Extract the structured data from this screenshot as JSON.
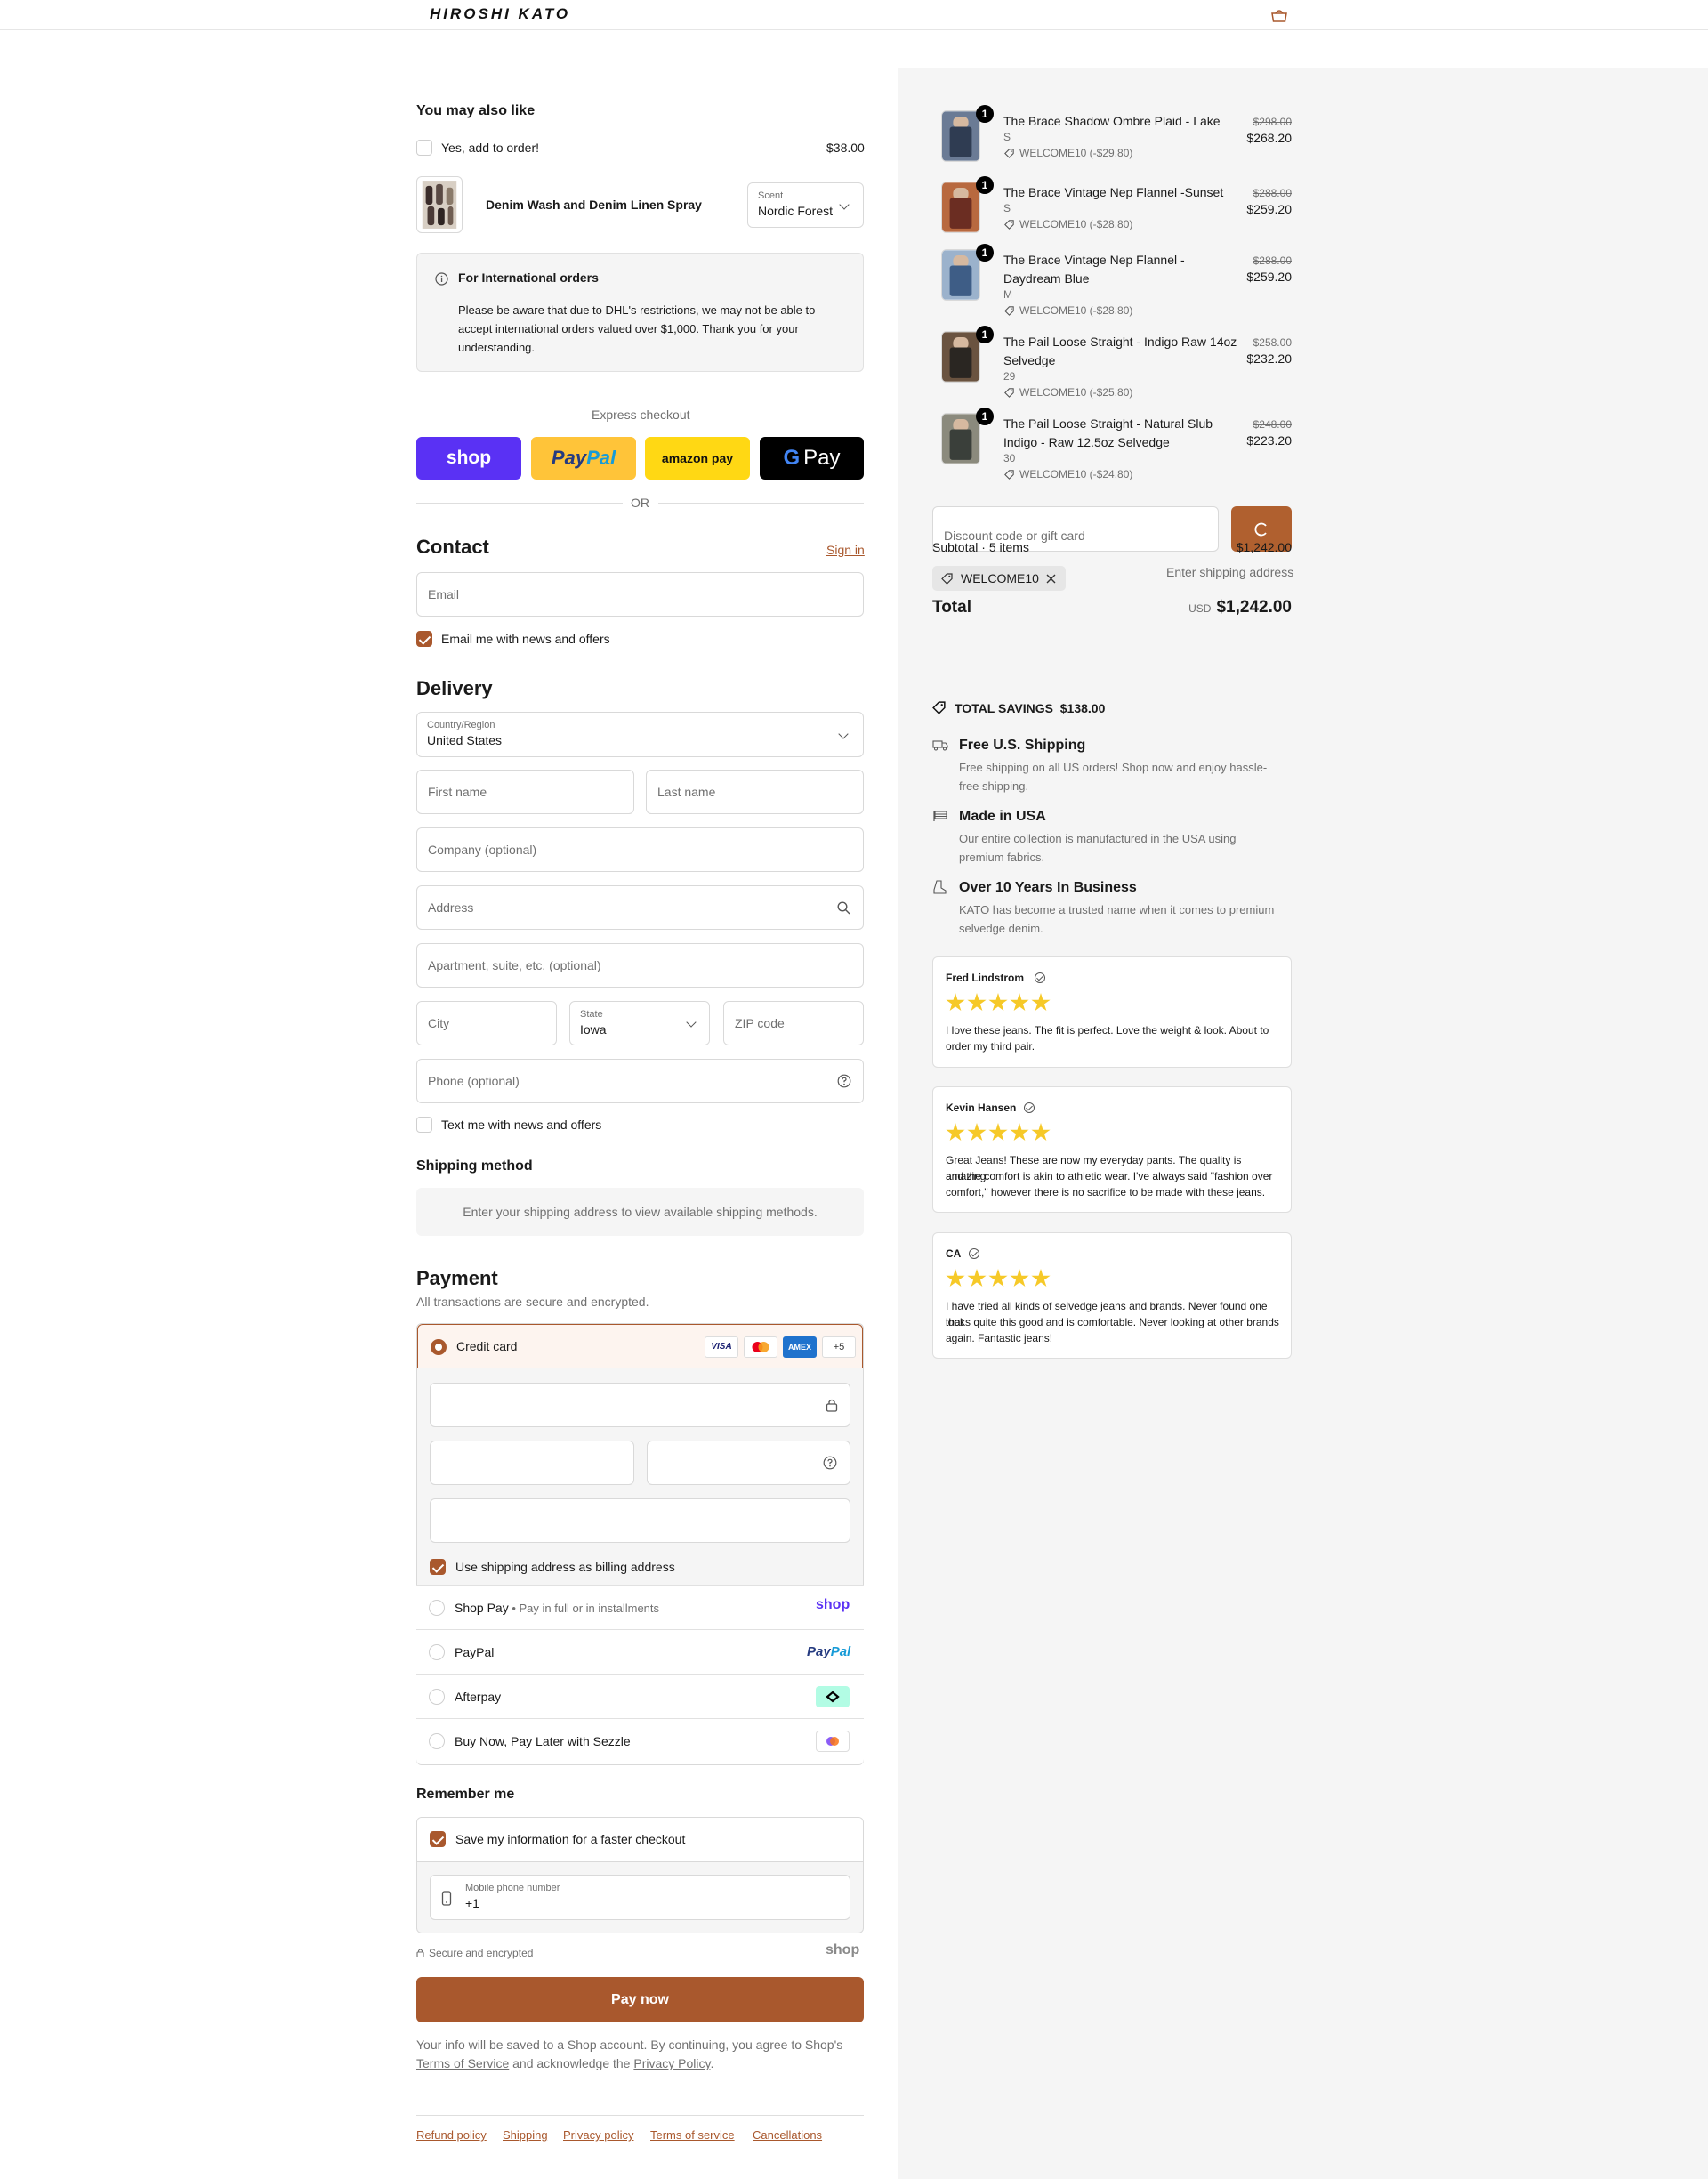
{
  "header": {
    "brand_logo_text": "HIROSHI KATO",
    "cart_icon": "bag-icon"
  },
  "upsell": {
    "heading": "You may also like",
    "add_label": "Yes, add to order!",
    "price": "$38.00",
    "product_name": "Denim Wash and Denim Linen Spray",
    "scent_label": "Scent",
    "scent_value": "Nordic Forest"
  },
  "notice": {
    "title": "For International orders",
    "lines": [
      "Please be aware that due to DHL's restrictions, we may not be able to",
      "accept international orders valued over $1,000. Thank you for your",
      "understanding."
    ]
  },
  "express": {
    "title": "Express checkout",
    "shop_label": "shop",
    "paypal_label_a": "Pay",
    "paypal_label_b": "Pal",
    "amazon_label": "amazon pay",
    "gpay_label": "Pay",
    "or_label": "OR"
  },
  "contact": {
    "heading": "Contact",
    "sign_in": "Sign in",
    "email_placeholder": "Email",
    "news_label": "Email me with news and offers"
  },
  "delivery": {
    "heading": "Delivery",
    "country_label": "Country/Region",
    "country_value": "United States",
    "first_name": "First name",
    "last_name": "Last name",
    "company": "Company (optional)",
    "address": "Address",
    "apartment": "Apartment, suite, etc. (optional)",
    "city": "City",
    "state_label": "State",
    "state_value": "Iowa",
    "zip": "ZIP code",
    "phone": "Phone (optional)",
    "text_label": "Text me with news and offers"
  },
  "shipping": {
    "heading": "Shipping method",
    "message": "Enter your shipping address to view available shipping methods."
  },
  "payment": {
    "heading": "Payment",
    "subtitle": "All transactions are secure and encrypted.",
    "credit_card": "Credit card",
    "card_badges": [
      "VISA",
      "",
      "AMEX",
      "+5"
    ],
    "billing_label": "Use shipping address as billing address",
    "shop_pay": "Shop Pay",
    "shop_pay_sub": "Pay in full or in installments",
    "shop_pay_logo": "shop",
    "paypal": "PayPal",
    "paypal_logo_a": "Pay",
    "paypal_logo_b": "Pal",
    "afterpay": "Afterpay",
    "sezzle": "Buy Now, Pay Later with Sezzle"
  },
  "remember": {
    "heading": "Remember me",
    "save_label": "Save my information for a faster checkout",
    "mobile_label": "Mobile phone number",
    "mobile_value": "+1",
    "secure_label": "Secure and encrypted",
    "shop_logo": "shop"
  },
  "pay_now": "Pay now",
  "legal": {
    "line1": "Your info will be saved to a Shop account. By continuing, you agree to Shop's",
    "terms": "Terms of Service",
    "middle": " and acknowledge the ",
    "privacy": "Privacy Policy",
    "end": "."
  },
  "footer_links": [
    "Refund policy",
    "Shipping",
    "Privacy policy",
    "Terms of service",
    "Cancellations"
  ],
  "order": {
    "items": [
      {
        "qty": "1",
        "title_lines": [
          "The Brace Shadow Ombre Plaid - Lake"
        ],
        "variant": "S",
        "discount": "WELCOME10 (-$29.80)",
        "original": "$298.00",
        "price": "$268.20"
      },
      {
        "qty": "1",
        "title_lines": [
          "The Brace Vintage Nep Flannel -Sunset"
        ],
        "variant": "S",
        "discount": "WELCOME10 (-$28.80)",
        "original": "$288.00",
        "price": "$259.20"
      },
      {
        "qty": "1",
        "title_lines": [
          "The Brace Vintage Nep Flannel -",
          "Daydream Blue"
        ],
        "variant": "M",
        "discount": "WELCOME10 (-$28.80)",
        "original": "$288.00",
        "price": "$259.20"
      },
      {
        "qty": "1",
        "title_lines": [
          "The Pail Loose Straight - Indigo Raw 14oz",
          "Selvedge"
        ],
        "variant": "29",
        "discount": "WELCOME10 (-$25.80)",
        "original": "$258.00",
        "price": "$232.20"
      },
      {
        "qty": "1",
        "title_lines": [
          "The Pail Loose Straight - Natural Slub",
          "Indigo - Raw 12.5oz Selvedge"
        ],
        "variant": "30",
        "discount": "WELCOME10 (-$24.80)",
        "original": "$248.00",
        "price": "$223.20"
      }
    ],
    "discount_placeholder": "Discount code or gift card",
    "subtotal_label": "Subtotal · 5 items",
    "subtotal_value": "$1,242.00",
    "code_chip": "WELCOME10",
    "shipping_note": "Enter shipping address",
    "total_label": "Total",
    "currency": "USD",
    "total_value": "$1,242.00",
    "savings_label": "TOTAL SAVINGS",
    "savings_value": "$138.00"
  },
  "benefits": [
    {
      "icon": "truck-icon",
      "title": "Free U.S. Shipping",
      "lines": [
        "Free shipping on all US orders! Shop now and enjoy hassle-",
        "free shipping."
      ]
    },
    {
      "icon": "flag-icon",
      "title": "Made in USA",
      "lines": [
        "Our entire collection is manufactured in the USA using",
        "premium fabrics."
      ]
    },
    {
      "icon": "boot-icon",
      "title": "Over 10 Years In Business",
      "lines": [
        "KATO has become a trusted name when it comes to premium",
        "selvedge denim."
      ]
    }
  ],
  "reviews": [
    {
      "name": "Fred Lindstrom",
      "rating": 5,
      "lines": [
        "I love these jeans. The fit is perfect. Love the weight & look. About to",
        "order my third pair."
      ]
    },
    {
      "name": "Kevin Hansen",
      "rating": 5,
      "lines": [
        "Great Jeans! These are now my everyday pants. The quality is amazing",
        "and the comfort is akin to athletic wear. I've always said \"fashion over",
        "comfort,\" however there is no sacrifice to be made with these jeans."
      ]
    },
    {
      "name": "CA",
      "rating": 5,
      "lines": [
        "I have tried all kinds of selvedge jeans and brands. Never found one that",
        "looks quite this good and is comfortable. Never looking at other brands",
        "again. Fantastic jeans!"
      ]
    }
  ],
  "colors": {
    "accent": "#a9582d",
    "shop_purple": "#5a31f4",
    "paypal_yellow": "#ffc439",
    "star": "#f6c928"
  }
}
